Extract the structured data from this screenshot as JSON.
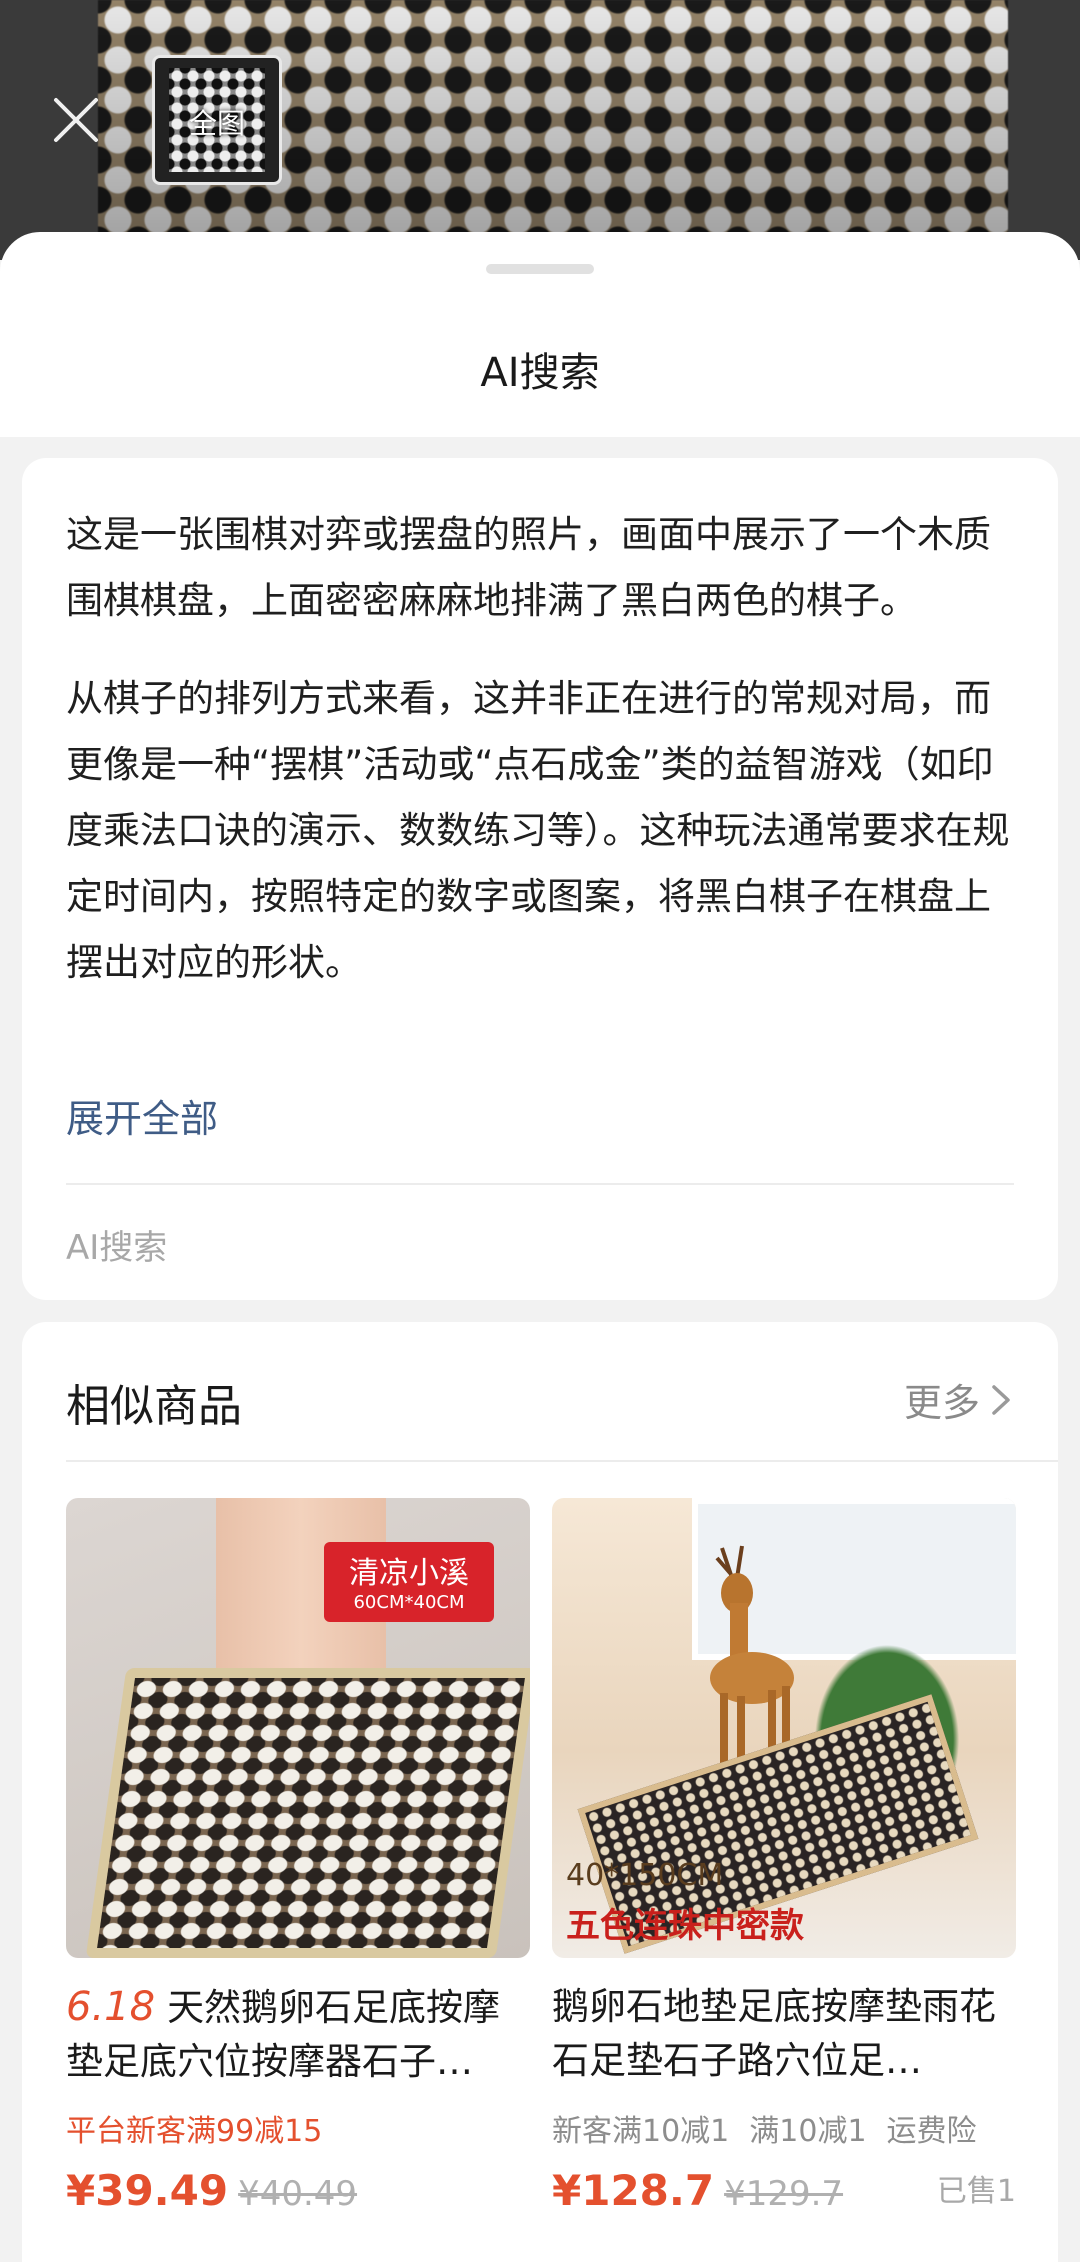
{
  "viewer": {
    "full_label": "全图"
  },
  "sheet": {
    "title": "AI搜索"
  },
  "ai_answer": {
    "paragraphs": [
      "这是一张围棋对弈或摆盘的照片，画面中展示了一个木质围棋棋盘，上面密密麻麻地排满了黑白两色的棋子。",
      "从棋子的排列方式来看，这并非正在进行的常规对局，而更像是一种“摆棋”活动或“点石成金”类的益智游戏（如印度乘法口诀的演示、数数练习等）。这种玩法通常要求在规定时间内，按照特定的数字或图案，将黑白棋子在棋盘上摆出对应的形状。"
    ],
    "expand_label": "展开全部",
    "footer_label": "AI搜索"
  },
  "similar": {
    "title": "相似商品",
    "more_label": "更多",
    "products": [
      {
        "image_tag_title": "清凉小溪",
        "image_tag_size": "60CM*40CM",
        "promo_badge": "6.18",
        "title": "天然鹅卵石足底按摩垫足底穴位按摩器石子…",
        "offer": "平台新客满99减15",
        "price": "¥39.49",
        "original_price": "¥40.49"
      },
      {
        "image_spec": "40*150CM",
        "image_label": "五色连珠中密款",
        "title": "鹅卵石地垫足底按摩垫雨花石足垫石子路穴位足…",
        "offers": [
          "新客满10减1",
          "满10减1",
          "运费险"
        ],
        "price": "¥128.7",
        "original_price": "¥129.7",
        "sold": "已售1"
      }
    ]
  },
  "colors": {
    "accent_price": "#e4502e",
    "link_blue": "#3f5c86"
  }
}
